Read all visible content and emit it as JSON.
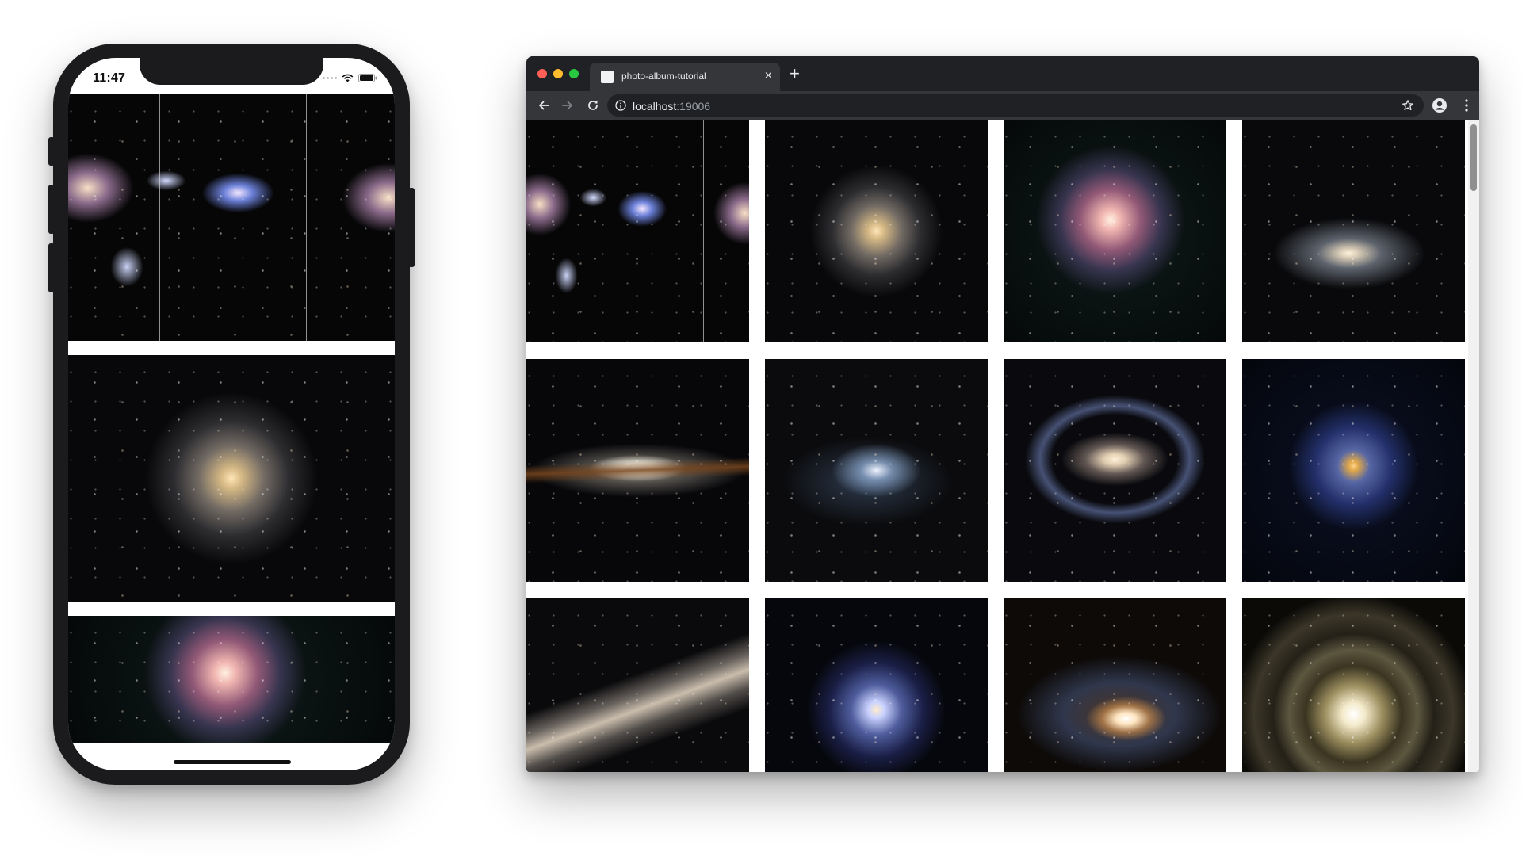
{
  "phone": {
    "status_time": "11:47",
    "icons": [
      "cellular-signal-icon",
      "wifi-icon",
      "battery-icon"
    ],
    "photos": [
      {
        "alt": "galaxy-group",
        "style": "multi"
      },
      {
        "alt": "spiral-galaxy",
        "style": "spiral1"
      },
      {
        "alt": "pink-spiral-galaxy",
        "style": "pink"
      }
    ]
  },
  "browser": {
    "tab_title": "photo-album-tutorial",
    "tab_close": "×",
    "new_tab": "+",
    "url_host": "localhost",
    "url_port": ":19006",
    "icons": [
      "back-arrow-icon",
      "forward-arrow-icon",
      "reload-icon",
      "info-icon",
      "star-icon",
      "profile-icon",
      "menu-icon"
    ]
  },
  "gallery": {
    "columns": 4,
    "photos": [
      {
        "style": "multi"
      },
      {
        "style": "spiral1"
      },
      {
        "style": "pink"
      },
      {
        "style": "tilted"
      },
      {
        "style": "edge"
      },
      {
        "style": "irreg"
      },
      {
        "style": "barred"
      },
      {
        "style": "blue"
      },
      {
        "style": "edge2"
      },
      {
        "style": "spiral2"
      },
      {
        "style": "golden"
      },
      {
        "style": "ring"
      }
    ]
  },
  "colors": {
    "traffic_close": "#fe5f57",
    "traffic_min": "#febc2e",
    "traffic_max": "#28c840",
    "browser_chrome": "#202124",
    "browser_toolbar": "#35363a"
  }
}
